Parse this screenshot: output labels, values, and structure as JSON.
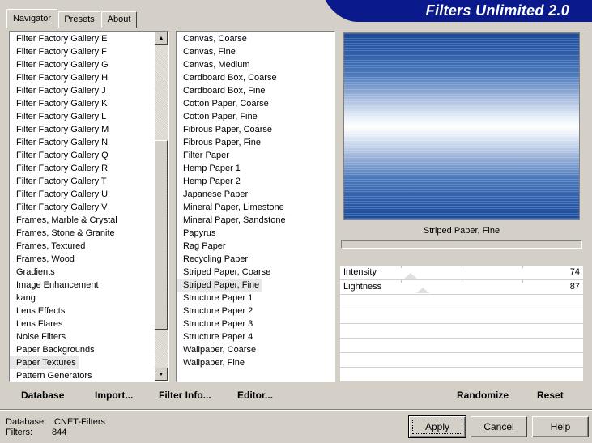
{
  "tabs": [
    {
      "label": "Navigator",
      "active": true
    },
    {
      "label": "Presets",
      "active": false
    },
    {
      "label": "About",
      "active": false
    }
  ],
  "banner": {
    "title": "Filters Unlimited 2.0"
  },
  "categories": {
    "items": [
      "Filter Factory Gallery E",
      "Filter Factory Gallery F",
      "Filter Factory Gallery G",
      "Filter Factory Gallery H",
      "Filter Factory Gallery J",
      "Filter Factory Gallery K",
      "Filter Factory Gallery L",
      "Filter Factory Gallery M",
      "Filter Factory Gallery N",
      "Filter Factory Gallery Q",
      "Filter Factory Gallery R",
      "Filter Factory Gallery T",
      "Filter Factory Gallery U",
      "Filter Factory Gallery V",
      "Frames, Marble & Crystal",
      "Frames, Stone & Granite",
      "Frames, Textured",
      "Frames, Wood",
      "Gradients",
      "Image Enhancement",
      "kang",
      "Lens Effects",
      "Lens Flares",
      "Noise Filters",
      "Paper Backgrounds",
      "Paper Textures",
      "Pattern Generators"
    ],
    "selected": "Paper Textures"
  },
  "filters": {
    "items": [
      "Canvas, Coarse",
      "Canvas, Fine",
      "Canvas, Medium",
      "Cardboard Box, Coarse",
      "Cardboard Box, Fine",
      "Cotton Paper, Coarse",
      "Cotton Paper, Fine",
      "Fibrous Paper, Coarse",
      "Fibrous Paper, Fine",
      "Filter Paper",
      "Hemp Paper 1",
      "Hemp Paper 2",
      "Japanese Paper",
      "Mineral Paper, Limestone",
      "Mineral Paper, Sandstone",
      "Papyrus",
      "Rag Paper",
      "Recycling Paper",
      "Striped Paper, Coarse",
      "Striped Paper, Fine",
      "Structure Paper 1",
      "Structure Paper 2",
      "Structure Paper 3",
      "Structure Paper 4",
      "Wallpaper, Coarse",
      "Wallpaper, Fine"
    ],
    "selected": "Striped Paper, Fine"
  },
  "preview": {
    "caption": "Striped Paper, Fine"
  },
  "params": [
    {
      "label": "Intensity",
      "value": "74"
    },
    {
      "label": "Lightness",
      "value": "87"
    }
  ],
  "actions": {
    "database": "Database",
    "import": "Import...",
    "filter_info": "Filter Info...",
    "editor": "Editor...",
    "randomize": "Randomize",
    "reset": "Reset"
  },
  "buttons": {
    "apply": "Apply",
    "cancel": "Cancel",
    "help": "Help"
  },
  "status": {
    "database_label": "Database:",
    "database_value": "ICNET-Filters",
    "filters_label": "Filters:",
    "filters_value": "844"
  }
}
